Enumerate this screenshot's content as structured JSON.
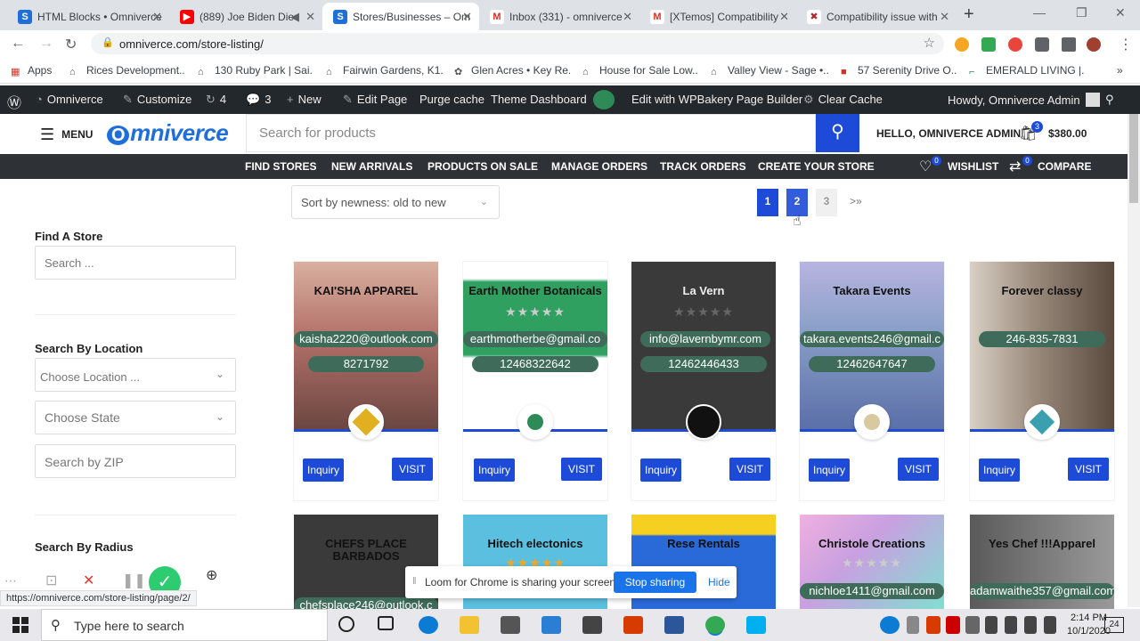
{
  "browser": {
    "tabs": [
      {
        "label": "HTML Blocks • Omniverce",
        "favicon_color": "#1e6fd9",
        "active": false
      },
      {
        "label": "(889) Joe Biden Die",
        "favicon_color": "#ff0000",
        "active": false
      },
      {
        "label": "Stores/Businesses – Om",
        "favicon_color": "#1e6fd9",
        "active": true
      },
      {
        "label": "Inbox (331) - omniverce",
        "favicon_color": "#d93025",
        "active": false
      },
      {
        "label": "[XTemos] Compatibility",
        "favicon_color": "#d93025",
        "active": false
      },
      {
        "label": "Compatibility issue with",
        "favicon_color": "#b0262e",
        "active": false
      }
    ],
    "url": "omniverce.com/store-listing/",
    "bookmarks": [
      "Apps",
      "Rices Development...",
      "130 Ruby Park | Sai...",
      "Fairwin Gardens, K1...",
      "Glen Acres • Key Re...",
      "House for Sale Low...",
      "Valley View - Sage •...",
      "57 Serenity Drive O...",
      "EMERALD LIVING |..."
    ],
    "status_url": "https://omniverce.com/store-listing/page/2/"
  },
  "wpbar": {
    "site": "Omniverce",
    "customize": "Customize",
    "updates": "4",
    "comments": "3",
    "new": "New",
    "edit_page": "Edit Page",
    "purge": "Purge cache",
    "theme_dashboard": "Theme Dashboard",
    "wpbakery": "Edit with WPBakery Page Builder",
    "clear_cache": "Clear Cache",
    "howdy": "Howdy, Omniverce Admin"
  },
  "header": {
    "menu": "MENU",
    "logo": "mniverce",
    "search_placeholder": "Search for products",
    "hello": "HELLO, OMNIVERCE ADMIN",
    "cart_count": "3",
    "cart_total": "$380.00"
  },
  "nav": {
    "links": [
      "FIND STORES",
      "NEW ARRIVALS",
      "PRODUCTS ON SALE",
      "MANAGE ORDERS",
      "TRACK ORDERS",
      "CREATE YOUR STORE"
    ],
    "wishlist": "WISHLIST",
    "wishlist_count": "0",
    "compare": "COMPARE",
    "compare_count": "0"
  },
  "sidebar": {
    "find_title": "Find A Store",
    "find_placeholder": "Search ...",
    "location_title": "Search By Location",
    "location_placeholder": "Choose Location ...",
    "state_placeholder": "Choose State",
    "zip_placeholder": "Search by ZIP",
    "radius_title": "Search By Radius"
  },
  "main": {
    "sort": "Sort by newness: old to new",
    "pages": [
      "1",
      "2",
      "3"
    ],
    "next": ">»",
    "inquiry": "Inquiry",
    "visit": "VISIT"
  },
  "stores": [
    {
      "name": "KAI'SHA APPAREL",
      "email": "kaisha2220@outlook.com",
      "phone": "8271792",
      "bg": "#c9968a",
      "avatar": "#e0b020"
    },
    {
      "name": "Earth Mother Botanicals",
      "email": "earthmotherbe@gmail.co",
      "phone": "12468322642",
      "bg": "#2fa060",
      "avatar": "#2e8b57"
    },
    {
      "name": "La Vern",
      "email": "info@lavernbymr.com",
      "phone": "12462446433",
      "bg": "#3a3a3a",
      "avatar": "#111111"
    },
    {
      "name": "Takara Events",
      "email": "takara.events246@gmail.c",
      "phone": "12462647647",
      "bg": "#8aa0c8",
      "avatar": "#d9c9a0"
    },
    {
      "name": "Forever classy",
      "email": "",
      "phone": "246-835-7831",
      "bg": "#6a5a4e",
      "avatar": "#3aa0b0"
    }
  ],
  "stores_row2": [
    {
      "name": "CHEFS PLACE BARBADOS",
      "email": "chefsplace246@outlook.c",
      "bg": "#3a3a3a"
    },
    {
      "name": "Hitech electonics",
      "email": "",
      "bg": "#5bc0e0"
    },
    {
      "name": "Rese Rentals",
      "email": "",
      "bg": "#2a6ad8"
    },
    {
      "name": "Christole Creations",
      "email": "nichloe1411@gmail.com",
      "bg": "#c8a0e0"
    },
    {
      "name": "Yes Chef !!!Apparel",
      "email": "adamwaithe357@gmail.com",
      "bg": "#7a7a7a"
    }
  ],
  "loom": {
    "message": "Loom for Chrome is sharing your screen.",
    "stop": "Stop sharing",
    "hide": "Hide"
  },
  "taskbar": {
    "search": "Type here to search",
    "time": "2:14 PM",
    "date": "10/1/2020",
    "notif": "24"
  }
}
